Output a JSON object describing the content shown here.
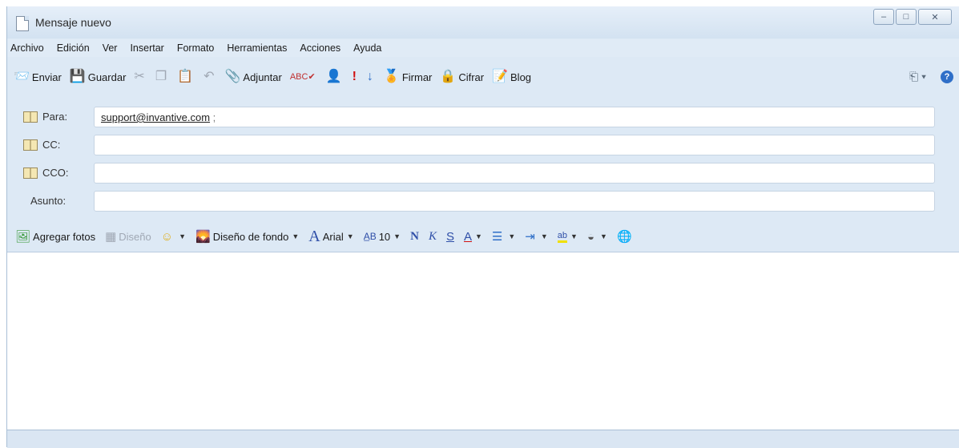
{
  "window": {
    "title": "Mensaje nuevo",
    "buttons": {
      "minimize": "–",
      "maximize": "□",
      "close": "✕"
    }
  },
  "menu": [
    "Archivo",
    "Edición",
    "Ver",
    "Insertar",
    "Formato",
    "Herramientas",
    "Acciones",
    "Ayuda"
  ],
  "toolbar": {
    "send": "Enviar",
    "save": "Guardar",
    "attach": "Adjuntar",
    "sign": "Firmar",
    "encrypt": "Cifrar",
    "blog": "Blog"
  },
  "headers": {
    "to_label": "Para:",
    "to_value": "support@invantive.com",
    "to_sep": ";",
    "cc_label": "CC:",
    "cc_value": "",
    "bcc_label": "CCO:",
    "bcc_value": "",
    "subject_label": "Asunto:",
    "subject_value": ""
  },
  "format": {
    "add_photos": "Agregar fotos",
    "design": "Diseño",
    "background": "Diseño de fondo",
    "font": "Arial",
    "size": "10",
    "bold": "N",
    "italic": "K",
    "underline": "S",
    "font_color": "A",
    "highlight": "ab"
  },
  "colors": {
    "accent": "#2f6fc8",
    "window_bg": "#dde9f5"
  }
}
